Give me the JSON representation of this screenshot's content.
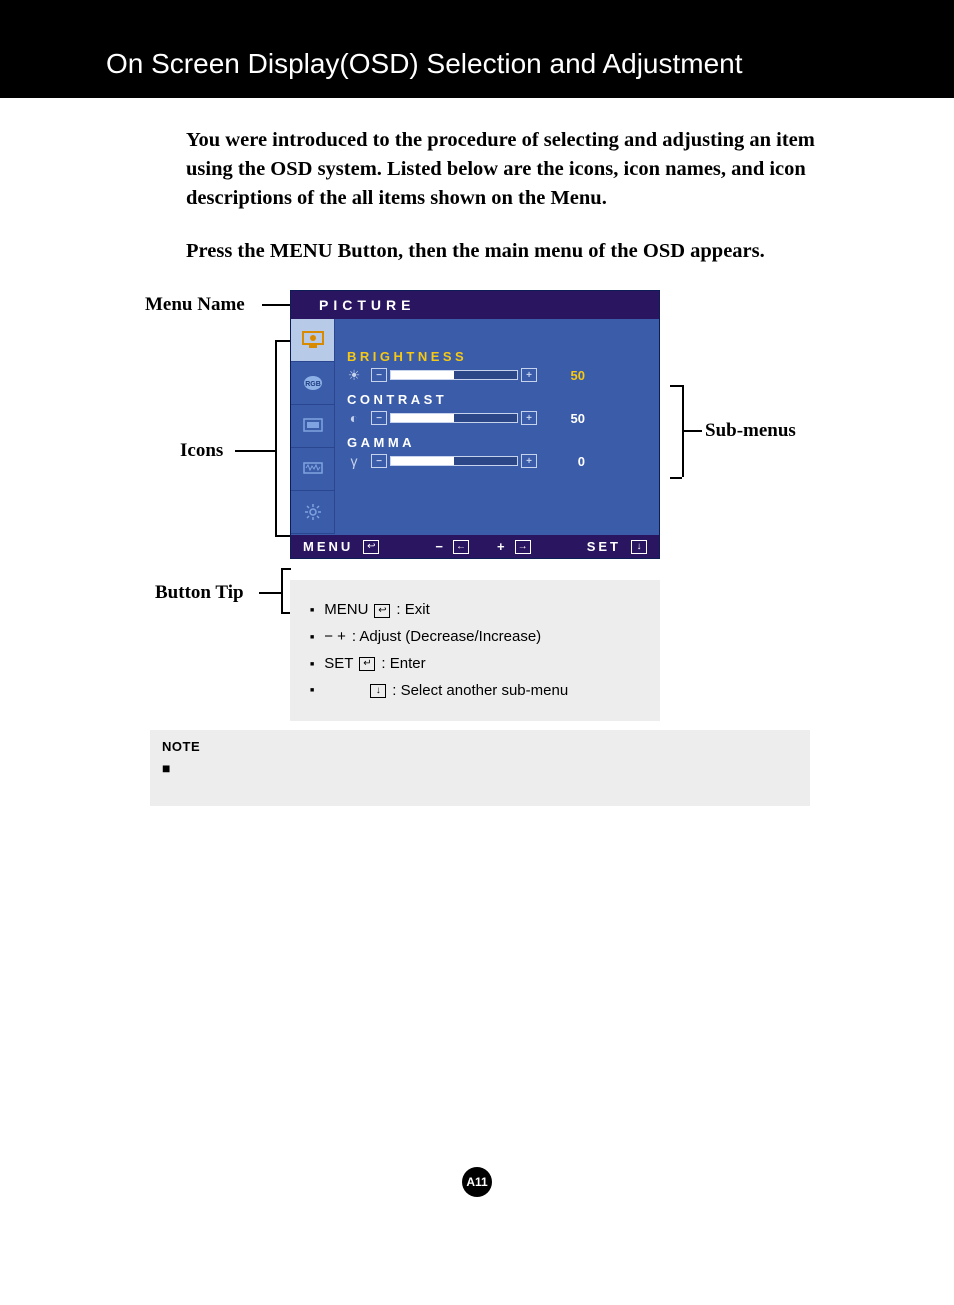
{
  "header": {
    "title": "On Screen Display(OSD) Selection and Adjustment"
  },
  "intro": {
    "para1": "You were introduced to the procedure of selecting and adjusting an item using the OSD system.  Listed below are the icons, icon names, and icon descriptions of the all items shown on the Menu.",
    "para2": "Press the MENU Button, then the main menu of the OSD appears."
  },
  "osd": {
    "title": "PICTURE",
    "sliders": [
      {
        "label": "BRIGHTNESS",
        "value": "50",
        "glyph": "☀",
        "fill": 50,
        "active": true
      },
      {
        "label": "CONTRAST",
        "value": "50",
        "glyph": "◐",
        "fill": 50,
        "active": false
      },
      {
        "label": "GAMMA",
        "value": "0",
        "glyph": "γ",
        "fill": 50,
        "active": false
      }
    ],
    "footer": {
      "menu": "MENU",
      "minus": "−",
      "plus": "+",
      "set": "SET"
    }
  },
  "annotations": {
    "menu_name": "Menu Name",
    "icons": "Icons",
    "button_tip": "Button Tip",
    "sub_menus": "Sub-menus"
  },
  "tips": {
    "rows": [
      {
        "lead": "MENU",
        "glyph": "exit",
        "text": ": Exit"
      },
      {
        "lead": "−   +",
        "glyph": "",
        "text": ": Adjust (Decrease/Increase)"
      },
      {
        "lead": "SET",
        "glyph": "enter",
        "text": ": Enter"
      },
      {
        "lead": "",
        "glyph": "down",
        "text": ": Select another sub-menu"
      }
    ]
  },
  "note": {
    "heading": "NOTE"
  },
  "page": {
    "number": "A11"
  }
}
